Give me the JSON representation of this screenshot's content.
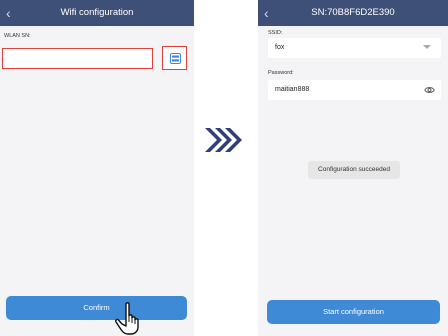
{
  "left_screen": {
    "title": "Wifi configuration",
    "back_icon": "chevron-left-icon",
    "wlan_sn_label": "WLAN SN:",
    "wlan_sn_value": "",
    "scan_icon": "barcode-scan-icon",
    "confirm_label": "Confirm",
    "pointer_icon": "hand-pointer-icon"
  },
  "transition_icon": "triple-chevron-right-icon",
  "right_screen": {
    "title": "SN:70B8F6D2E390",
    "back_icon": "chevron-left-icon",
    "ssid_label": "SSID:",
    "ssid_value": "fox",
    "dropdown_icon": "caret-down-icon",
    "password_label": "Password:",
    "password_value": "maitian888",
    "eye_icon": "eye-icon",
    "toast": "Configuration succeeded",
    "start_label": "Start configuration"
  },
  "colors": {
    "titlebar": "#3e5078",
    "button": "#3f8ad6",
    "highlight": "#e0403a",
    "arrows": "#2f3f7a",
    "background": "#f4f4f6"
  }
}
